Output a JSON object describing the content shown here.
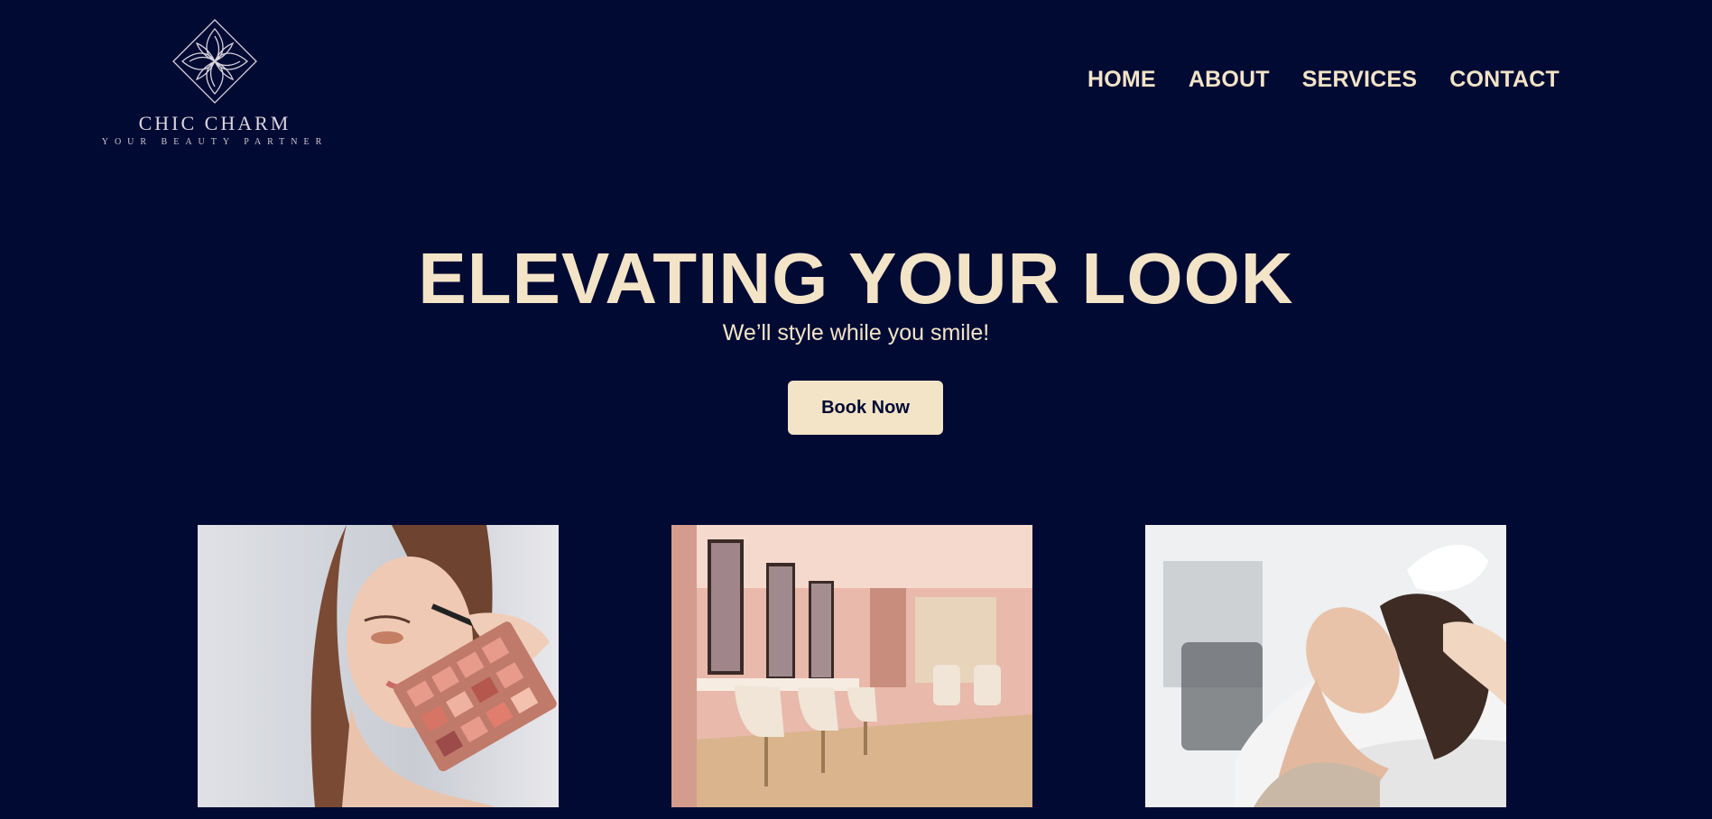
{
  "brand": {
    "name": "CHIC CHARM",
    "tagline": "YOUR BEAUTY PARTNER",
    "icon": "floral-diamond-logo"
  },
  "nav": {
    "items": [
      {
        "label": "HOME"
      },
      {
        "label": "ABOUT"
      },
      {
        "label": "SERVICES"
      },
      {
        "label": "CONTACT"
      }
    ]
  },
  "hero": {
    "title": "ELEVATING YOUR LOOK",
    "subtitle": "We’ll style while you smile!",
    "cta_label": "Book Now"
  },
  "gallery": [
    {
      "name": "makeup-photo"
    },
    {
      "name": "salon-interior-photo"
    },
    {
      "name": "hair-wash-photo"
    }
  ],
  "colors": {
    "background": "#000a33",
    "accent": "#f3e4c8"
  }
}
